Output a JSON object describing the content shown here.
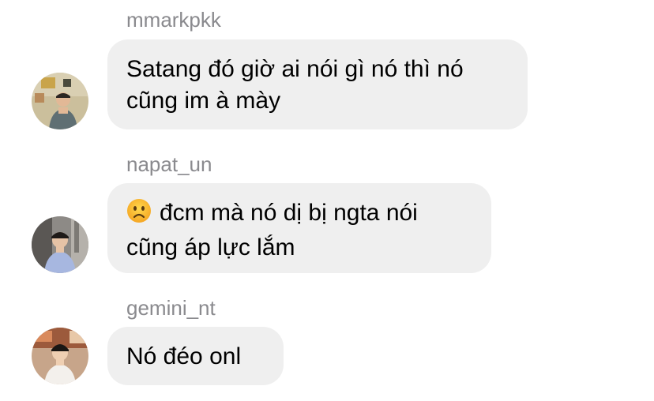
{
  "messages": [
    {
      "sender": "mmarkpkk",
      "lines": [
        "Satang đó giờ ai nói gì nó thì nó",
        "cũng im à mày"
      ]
    },
    {
      "sender": "napat_un",
      "emoji": "frowning-face",
      "lines": [
        "đcm mà nó dị bị ngta nói",
        "cũng áp lực lắm"
      ]
    },
    {
      "sender": "gemini_nt",
      "lines": [
        "Nó đéo onl"
      ]
    }
  ],
  "colors": {
    "bubble_background": "#efefef",
    "sender_name": "#8a8a8e",
    "message_text": "#000000",
    "page_background": "#ffffff"
  }
}
